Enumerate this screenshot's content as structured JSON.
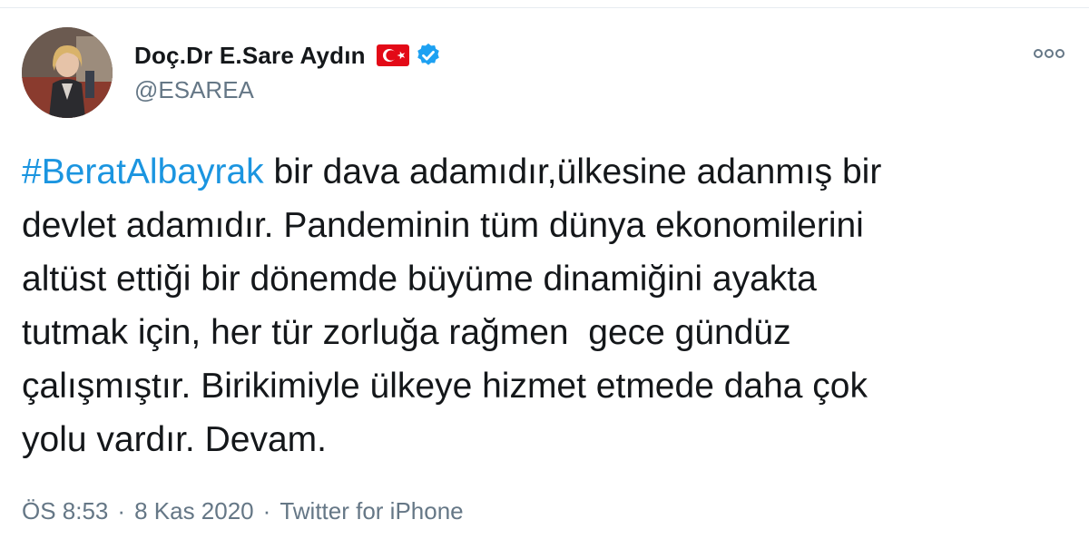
{
  "tweet": {
    "author": {
      "display_name": "Doç.Dr E.Sare Aydın",
      "handle": "@ESAREA",
      "flag_icon": "turkey-flag-icon",
      "verified_icon": "verified-badge-icon"
    },
    "more_icon": "more-horizontal-icon",
    "hashtag": "#BeratAlbayrak",
    "body_text": " bir dava adamıdır,ülkesine adanmış bir\ndevlet adamıdır. Pandeminin tüm dünya ekonomilerini\naltüst ettiği bir dönemde büyüme dinamiğini ayakta\ntutmak için, her tür zorluğa rağmen  gece gündüz\nçalışmıştır. Birikimiyle ülkeye hizmet etmede daha çok\nyolu vardır. Devam.",
    "time": "ÖS 8:53",
    "separator": "·",
    "date": "8 Kas 2020",
    "source": "Twitter for iPhone"
  },
  "colors": {
    "hashtag": "#1b95e0",
    "verified": "#1da1f2",
    "flag_red": "#e30a17",
    "secondary_text": "#657786",
    "primary_text": "#14171a"
  }
}
